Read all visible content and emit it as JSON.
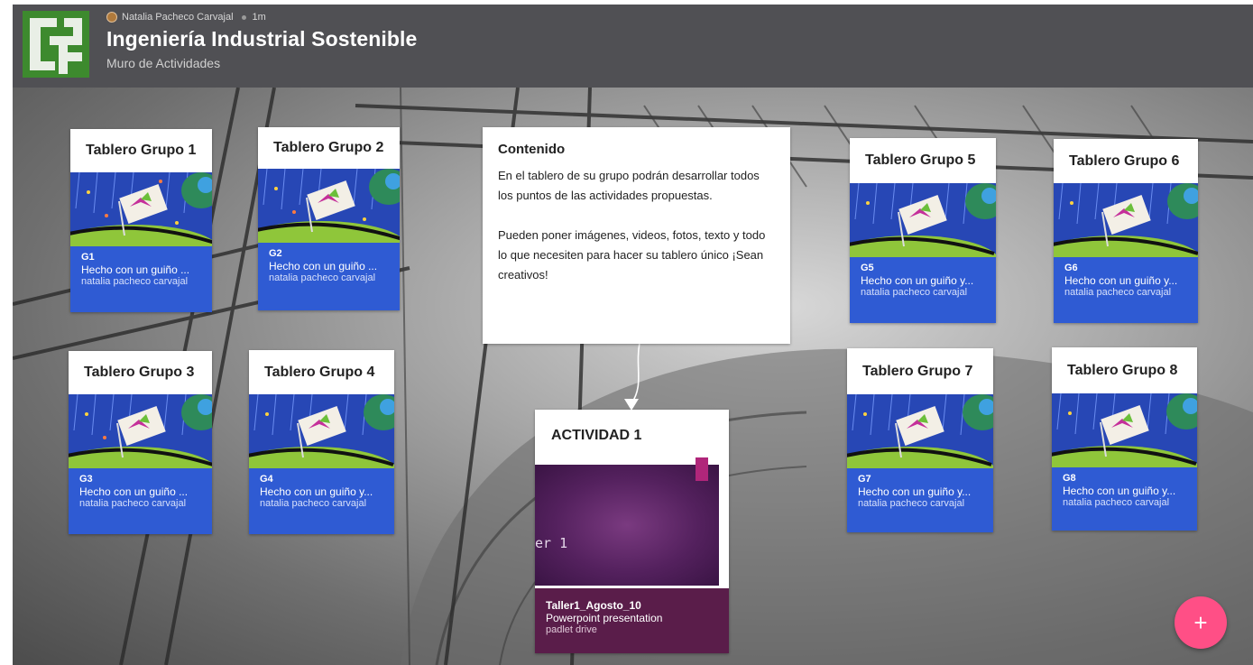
{
  "header": {
    "author": "Natalia Pacheco Carvajal",
    "time": "1m",
    "title": "Ingeniería Industrial Sostenible",
    "subtitle": "Muro de Actividades"
  },
  "groups": [
    {
      "heading": "Tablero Grupo 1",
      "code": "G1",
      "desc": "Hecho con un guiño ...",
      "owner": "natalia pacheco carvajal"
    },
    {
      "heading": "Tablero Grupo 2",
      "code": "G2",
      "desc": "Hecho con un guiño ...",
      "owner": "natalia pacheco carvajal"
    },
    {
      "heading": "Tablero Grupo 3",
      "code": "G3",
      "desc": "Hecho con un guiño ...",
      "owner": "natalia pacheco carvajal"
    },
    {
      "heading": "Tablero Grupo 4",
      "code": "G4",
      "desc": "Hecho con un guiño y...",
      "owner": "natalia pacheco carvajal"
    },
    {
      "heading": "Tablero Grupo 5",
      "code": "G5",
      "desc": "Hecho con un guiño y...",
      "owner": "natalia pacheco carvajal"
    },
    {
      "heading": "Tablero Grupo 6",
      "code": "G6",
      "desc": "Hecho con un guiño y...",
      "owner": "natalia pacheco carvajal"
    },
    {
      "heading": "Tablero Grupo 7",
      "code": "G7",
      "desc": "Hecho con un guiño y...",
      "owner": "natalia pacheco carvajal"
    },
    {
      "heading": "Tablero Grupo 8",
      "code": "G8",
      "desc": "Hecho con un guiño y...",
      "owner": "natalia pacheco carvajal"
    }
  ],
  "contenido": {
    "title": "Contenido",
    "p1": "En el tablero de su grupo podrán desarrollar todos los puntos de las actividades propuestas.",
    "p2": "Pueden poner imágenes, videos, fotos, texto y todo lo que necesiten para hacer su tablero único ¡Sean creativos!"
  },
  "actividad": {
    "heading": "ACTIVIDAD 1",
    "slide_text": "er 1",
    "file": "Taller1_Agosto_10",
    "type": "Powerpoint presentation",
    "source": "padlet drive"
  },
  "fab": {
    "label": "+"
  },
  "colors": {
    "card_blue": "#2f5bd3",
    "header_bg": "#505054",
    "fab_pink": "#ff4f86",
    "logo_green": "#3d8a2e"
  }
}
